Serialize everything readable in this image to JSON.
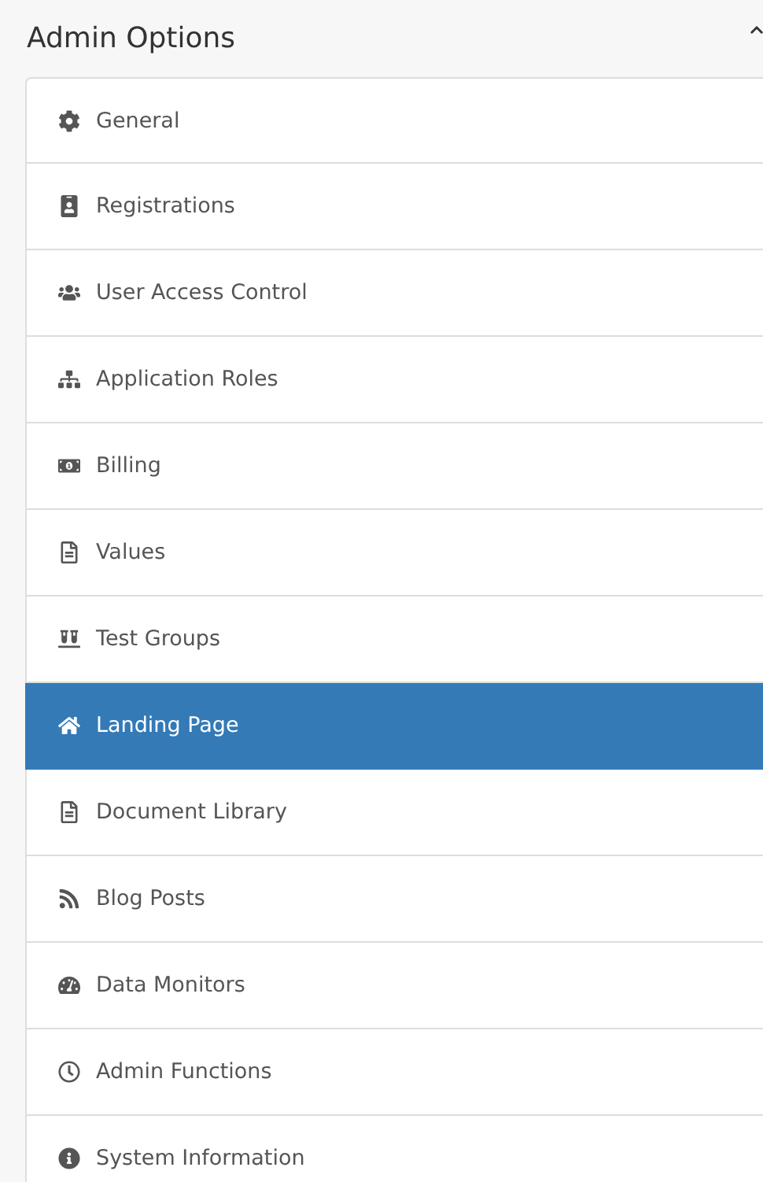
{
  "panel": {
    "title": "Admin Options",
    "expanded": true
  },
  "menu": [
    {
      "label": "General",
      "selected": false
    },
    {
      "label": "Registrations",
      "selected": false
    },
    {
      "label": "User Access Control",
      "selected": false
    },
    {
      "label": "Application Roles",
      "selected": false
    },
    {
      "label": "Billing",
      "selected": false
    },
    {
      "label": "Values",
      "selected": false
    },
    {
      "label": "Test Groups",
      "selected": false
    },
    {
      "label": "Landing Page",
      "selected": true
    },
    {
      "label": "Document Library",
      "selected": false
    },
    {
      "label": "Blog Posts",
      "selected": false
    },
    {
      "label": "Data Monitors",
      "selected": false
    },
    {
      "label": "Admin Functions",
      "selected": false
    },
    {
      "label": "System Information",
      "selected": false
    }
  ]
}
